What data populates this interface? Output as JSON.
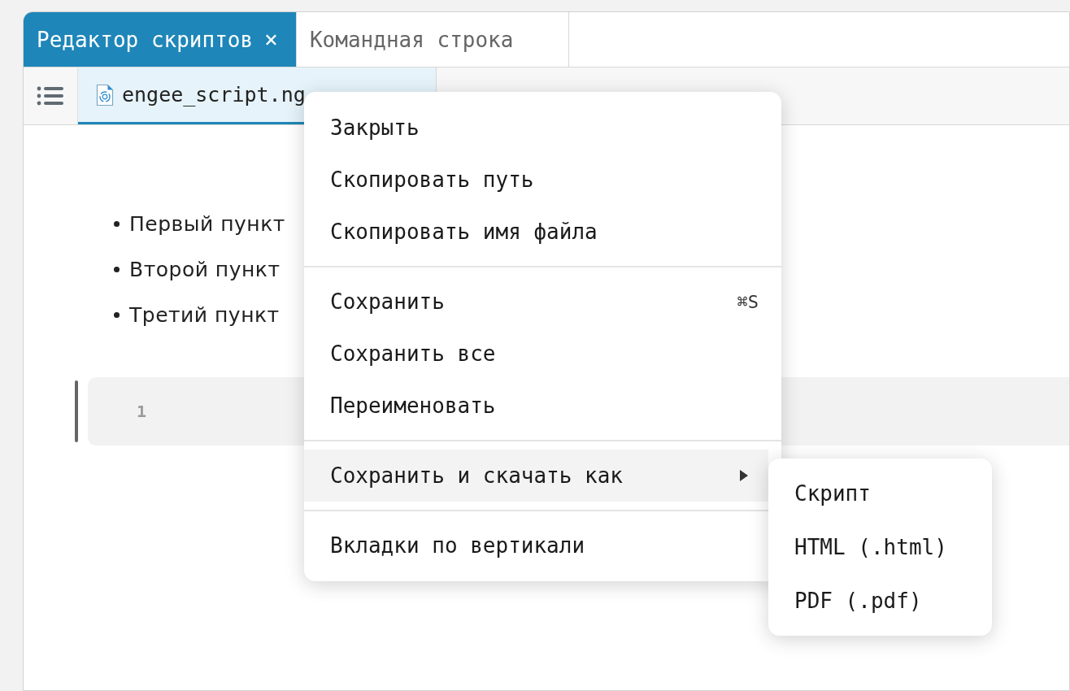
{
  "panel_tabs": [
    {
      "label": "Редактор скриптов",
      "close": "×",
      "selected": true
    },
    {
      "label": "Командная строка",
      "selected": false
    }
  ],
  "file_tabs": [
    {
      "label": "engee_script.ng",
      "selected": true
    }
  ],
  "content": {
    "bullets": [
      "Первый пункт",
      "Второй пункт",
      "Третий пункт"
    ],
    "code_cell": {
      "line_number": "1"
    }
  },
  "context_menu": {
    "groups": [
      [
        {
          "label": "Закрыть",
          "highlighted": false
        },
        {
          "label": "Скопировать путь",
          "highlighted": false
        },
        {
          "label": "Скопировать имя файла",
          "highlighted": false
        }
      ],
      [
        {
          "label": "Сохранить",
          "shortcut": "⌘S",
          "highlighted": false
        },
        {
          "label": "Сохранить все",
          "highlighted": false
        },
        {
          "label": "Переименовать",
          "highlighted": false
        }
      ],
      [
        {
          "label": "Сохранить и скачать как",
          "has_submenu": true,
          "highlighted": true
        }
      ],
      [
        {
          "label": "Вкладки по вертикали",
          "highlighted": false
        }
      ]
    ],
    "submenu": [
      {
        "label": "Скрипт",
        "highlighted": false
      },
      {
        "label": "HTML (.html)",
        "highlighted": false
      },
      {
        "label": "PDF (.pdf)",
        "highlighted": false
      }
    ]
  }
}
